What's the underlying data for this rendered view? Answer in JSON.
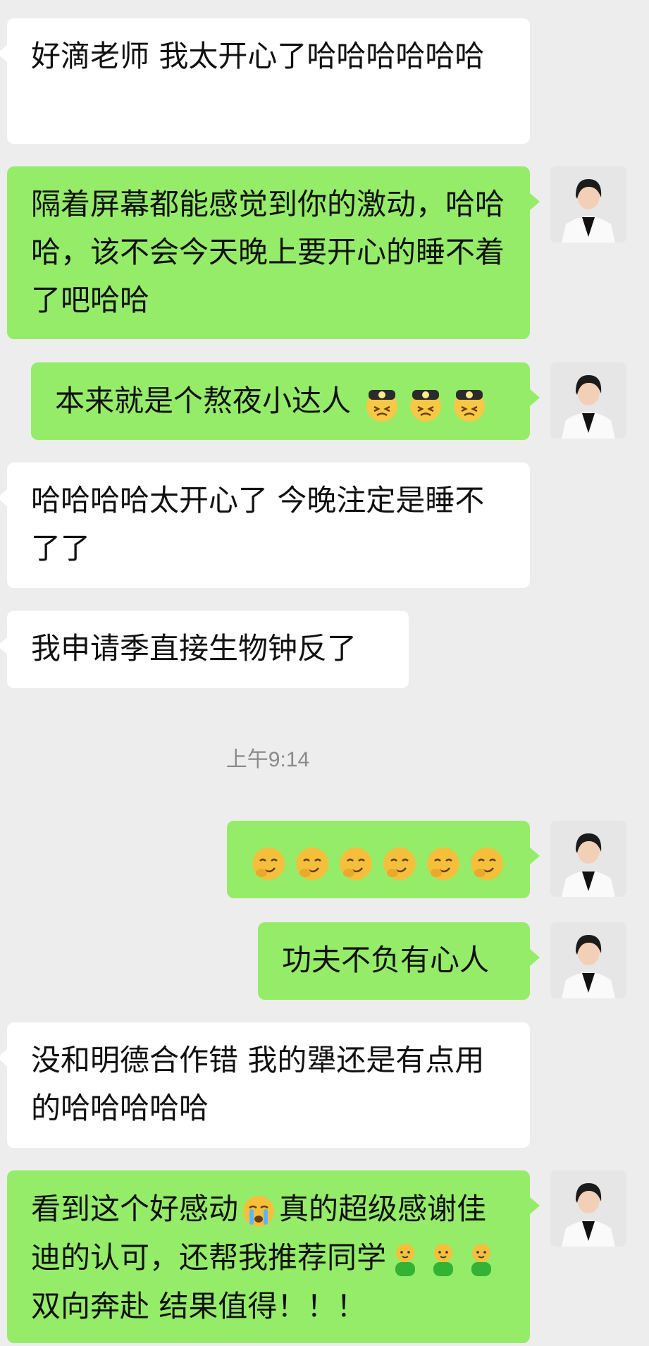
{
  "messages": [
    {
      "from": "contact",
      "text": "好滴老师 我太开心了哈哈哈哈哈哈"
    },
    {
      "from": "me",
      "text": "隔着屏幕都能感觉到你的激动，哈哈哈，该不会今天晚上要开心的睡不着了吧哈哈"
    },
    {
      "from": "me",
      "text": "本来就是个熬夜小达人",
      "emoji": "miner-emoji x3"
    },
    {
      "from": "contact",
      "text": "哈哈哈哈太开心了 今晚注定是睡不了了"
    },
    {
      "from": "contact",
      "text": "我申请季直接生物钟反了"
    },
    {
      "from": "me",
      "emoji": "smirk-emoji x6"
    },
    {
      "from": "me",
      "text": "功夫不负有心人"
    },
    {
      "from": "contact",
      "text": "没和明德合作错 我的犟还是有点用的哈哈哈哈哈"
    },
    {
      "from": "me",
      "text_a": "看到这个好感动",
      "emoji_a": "crying-emoji",
      "text_b": "真的超级感谢佳迪的认可，还帮我推荐同学",
      "emoji_b": "buddy-emoji x3",
      "text_c": "双向奔赴 结果值得！！！"
    }
  ],
  "timestamp": "上午9:14",
  "colors": {
    "background": "#ededed",
    "incoming_bubble": "#ffffff",
    "outgoing_bubble": "#95ec69",
    "timestamp_text": "#8a8a8a"
  }
}
